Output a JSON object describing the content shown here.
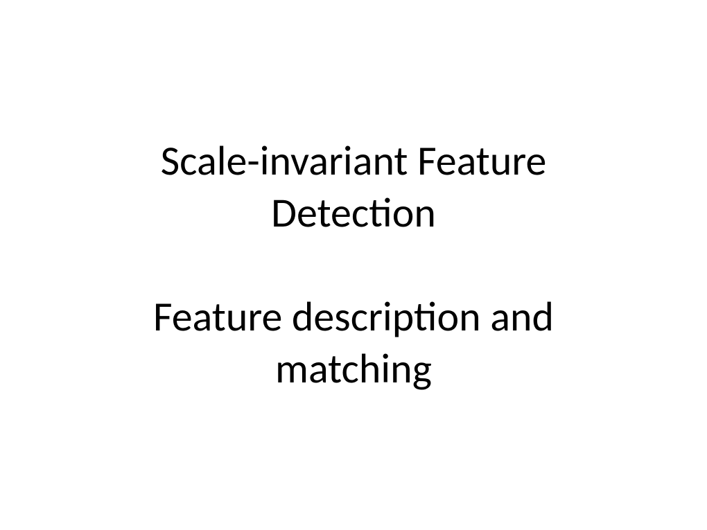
{
  "slide": {
    "title_line1": "Scale-invariant Feature",
    "title_line2": "Detection",
    "subtitle_line1": "Feature description and",
    "subtitle_line2": "matching"
  }
}
